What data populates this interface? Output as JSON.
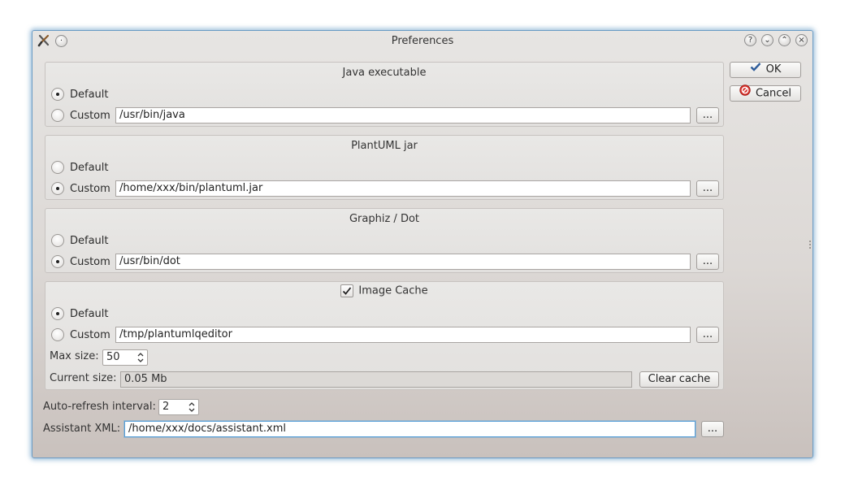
{
  "window": {
    "title": "Preferences",
    "titlebar_buttons": [
      "?",
      "⌄",
      "⌃",
      "×"
    ]
  },
  "side_buttons": {
    "ok": "OK",
    "cancel": "Cancel"
  },
  "java": {
    "title": "Java executable",
    "default_label": "Default",
    "custom_label": "Custom",
    "custom_value": "/usr/bin/java",
    "selected": "default",
    "browse_label": "..."
  },
  "plantuml": {
    "title": "PlantUML jar",
    "default_label": "Default",
    "custom_label": "Custom",
    "custom_value": "/home/xxx/bin/plantuml.jar",
    "selected": "custom",
    "browse_label": "..."
  },
  "graphviz": {
    "title": "Graphiz / Dot",
    "default_label": "Default",
    "custom_label": "Custom",
    "custom_value": "/usr/bin/dot",
    "selected": "custom",
    "browse_label": "..."
  },
  "cache": {
    "title": "Image Cache",
    "enabled": true,
    "default_label": "Default",
    "custom_label": "Custom",
    "custom_value": "/tmp/plantumlqeditor",
    "selected": "default",
    "browse_label": "...",
    "max_size_label": "Max size:",
    "max_size_value": "50",
    "current_size_label": "Current size:",
    "current_size_value": "0.05 Mb",
    "clear_label": "Clear cache"
  },
  "refresh": {
    "label": "Auto-refresh interval:",
    "value": "2"
  },
  "assistant": {
    "label": "Assistant XML:",
    "value": "/home/xxx/docs/assistant.xml",
    "browse_label": "..."
  },
  "colors": {
    "focus": "#5aa0d8",
    "window_border": "#6b9cc4"
  }
}
